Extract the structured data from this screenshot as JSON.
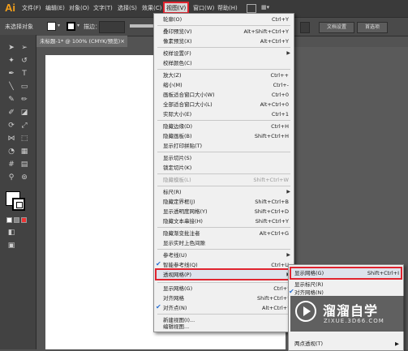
{
  "app": {
    "logo": "Ai"
  },
  "menubar": {
    "items": [
      "文件(F)",
      "编辑(E)",
      "对象(O)",
      "文字(T)",
      "选择(S)",
      "效果(C)",
      "视图(V)",
      "窗口(W)",
      "帮助(H)"
    ],
    "grid_label": "▦▾"
  },
  "controlbar": {
    "no_selection": "未选择对象",
    "stroke_label": "描边：",
    "doc_setup": "文档设置",
    "preferences": "首选项"
  },
  "document": {
    "tab_title": "未标题-1* @ 100% (CMYK/预览)",
    "close": "×"
  },
  "view_menu": {
    "items": [
      {
        "label": "轮廓(O)",
        "shortcut": "Ctrl+Y"
      },
      {
        "label": "叠印预览(V)",
        "shortcut": "Alt+Shift+Ctrl+Y"
      },
      {
        "label": "像素预览(X)",
        "shortcut": "Alt+Ctrl+Y"
      },
      {
        "label": "校样设置(F)",
        "shortcut": "",
        "submenu": true
      },
      {
        "label": "校样颜色(C)",
        "shortcut": ""
      },
      {
        "label": "放大(Z)",
        "shortcut": "Ctrl++"
      },
      {
        "label": "缩小(M)",
        "shortcut": "Ctrl+-"
      },
      {
        "label": "画板适合窗口大小(W)",
        "shortcut": "Ctrl+0"
      },
      {
        "label": "全部适合窗口大小(L)",
        "shortcut": "Alt+Ctrl+0"
      },
      {
        "label": "实际大小(E)",
        "shortcut": "Ctrl+1"
      },
      {
        "label": "隐藏边缘(D)",
        "shortcut": "Ctrl+H"
      },
      {
        "label": "隐藏画板(B)",
        "shortcut": "Shift+Ctrl+H"
      },
      {
        "label": "显示打印拼贴(T)",
        "shortcut": ""
      },
      {
        "label": "显示切片(S)",
        "shortcut": ""
      },
      {
        "label": "锁定切片(K)",
        "shortcut": ""
      },
      {
        "label": "隐藏模板(L)",
        "shortcut": "Shift+Ctrl+W",
        "disabled": true
      },
      {
        "label": "标尺(R)",
        "shortcut": "",
        "submenu": true
      },
      {
        "label": "隐藏定界框(J)",
        "shortcut": "Shift+Ctrl+B"
      },
      {
        "label": "显示透明度网格(Y)",
        "shortcut": "Shift+Ctrl+D"
      },
      {
        "label": "隐藏文本串接(H)",
        "shortcut": "Shift+Ctrl+Y"
      },
      {
        "label": "隐藏渐变批注者",
        "shortcut": "Alt+Ctrl+G"
      },
      {
        "label": "显示实时上色间隙",
        "shortcut": ""
      },
      {
        "label": "参考线(U)",
        "shortcut": "",
        "submenu": true
      },
      {
        "label": "智能参考线(Q)",
        "shortcut": "Ctrl+U",
        "checked": true
      },
      {
        "label": "透视网格(P)",
        "shortcut": "",
        "submenu": true
      },
      {
        "label": "显示网格(G)",
        "shortcut": "Ctrl+'"
      },
      {
        "label": "对齐网格",
        "shortcut": "Shift+Ctrl+'"
      },
      {
        "label": "对齐点(N)",
        "shortcut": "Alt+Ctrl+'",
        "checked": true
      },
      {
        "label": "新建视图(I)...",
        "shortcut": ""
      },
      {
        "label": "编辑视图...",
        "shortcut": ""
      }
    ]
  },
  "sub_menu": {
    "items": [
      {
        "label": "显示网格(G)",
        "shortcut": "Shift+Ctrl+I"
      },
      {
        "label": "显示标尺(R)",
        "shortcut": ""
      },
      {
        "label": "对齐网格(N)",
        "shortcut": "",
        "checked": true
      },
      {
        "label": "两点透视(T)",
        "shortcut": "",
        "submenu": true
      }
    ]
  },
  "watermark": {
    "title": "溜溜自学",
    "url": "ZIXUE.3D66.COM"
  }
}
